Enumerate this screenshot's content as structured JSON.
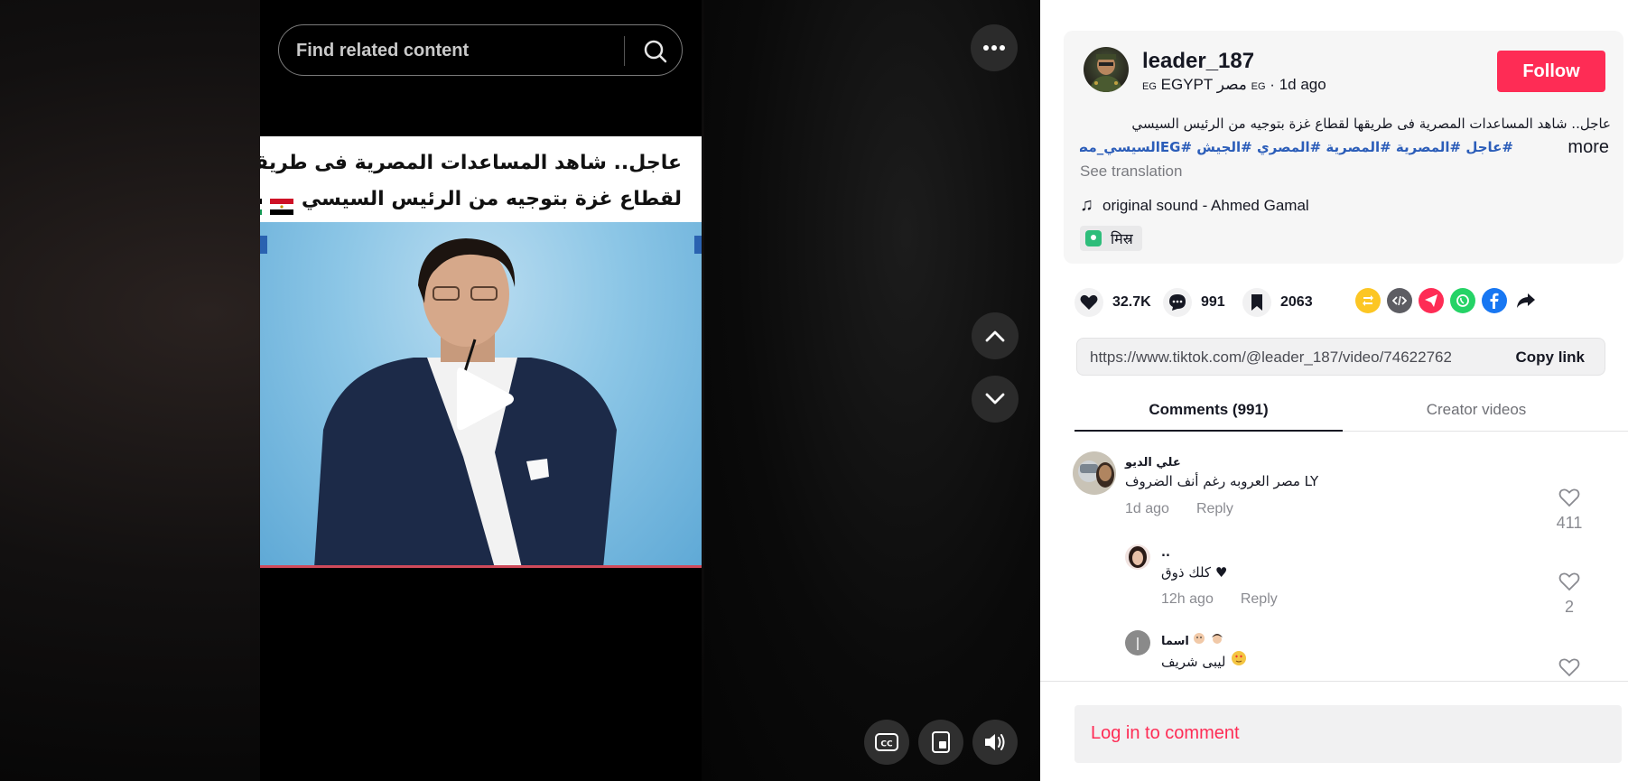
{
  "search": {
    "placeholder": "Find related content"
  },
  "video": {
    "caption_line1": "عاجل.. شاهد المساعدات المصرية فى طريقها",
    "caption_line2": "لقطاع غزة بتوجيه من الرئيس السيسي"
  },
  "author": {
    "username": "leader_187",
    "country_code_1": "EG",
    "country_name": "EGYPT مصر",
    "country_code_2": "EG",
    "time_ago": "1d ago",
    "follow_label": "Follow"
  },
  "description": {
    "text": "عاجل.. شاهد المساعدات المصرية فى طريقها لقطاع غزة بتوجيه من الرئيس السيسي",
    "hashtags": "#عاجل #المصرية #المصرية #المصري #الجيش #EGالسيسي_مصر...",
    "more_label": "more",
    "see_translation": "See translation"
  },
  "sound": {
    "label": "original sound - Ahmed Gamal"
  },
  "location": {
    "label": "मिस्र"
  },
  "stats": {
    "likes": "32.7K",
    "comments": "991",
    "saves": "2063"
  },
  "share": {
    "icons": [
      "repost-icon",
      "embed-icon",
      "telegram-icon",
      "whatsapp-icon",
      "facebook-icon",
      "share-arrow-icon"
    ],
    "colors": [
      "#fcc624",
      "#5d5d63",
      "#fe2c55",
      "#25d366",
      "#1877f2",
      "#161823"
    ]
  },
  "link": {
    "url": "https://www.tiktok.com/@leader_187/video/74622762...",
    "copy_label": "Copy link"
  },
  "tabs": {
    "comments": "Comments (991)",
    "creator": "Creator videos"
  },
  "comments": [
    {
      "name": "علي الديو",
      "text": "مصر العروبه رغم أنف الضروف LY",
      "time": "1d ago",
      "reply": "Reply",
      "likes": "411"
    },
    {
      "name": "..",
      "text": "كلك ذوق ♥",
      "time": "12h ago",
      "reply": "Reply",
      "likes": "2"
    },
    {
      "name": "اسما",
      "text": "ليبى شريف",
      "likes": ""
    }
  ],
  "footer": {
    "login_label": "Log in to comment"
  },
  "colors": {
    "accent": "#fe2c55",
    "link": "#2b5db9"
  }
}
